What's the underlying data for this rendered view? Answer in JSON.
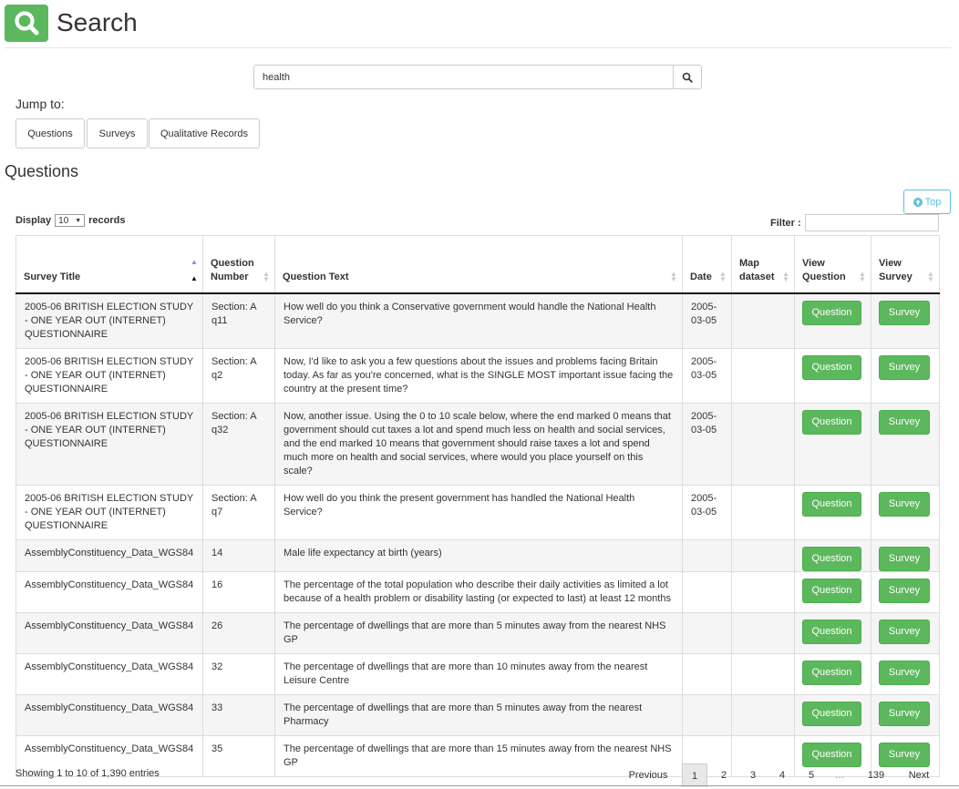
{
  "header": {
    "title": "Search",
    "logo_icon": "search-icon",
    "brand_color": "#5cb85c"
  },
  "search": {
    "value": "health",
    "button_icon": "search-icon"
  },
  "jump": {
    "label": "Jump to:",
    "buttons": [
      "Questions",
      "Surveys",
      "Qualitative Records"
    ]
  },
  "section": {
    "title": "Questions",
    "top_label": "Top",
    "top_icon": "arrow-up-circle-icon"
  },
  "table_controls": {
    "display_prefix": "Display",
    "display_value": "10",
    "display_suffix": "records",
    "filter_label": "Filter :",
    "filter_value": ""
  },
  "table": {
    "headers": [
      [
        "Survey Title"
      ],
      [
        "Question",
        "Number"
      ],
      [
        "Question Text"
      ],
      [
        "Date"
      ],
      [
        "Map",
        "dataset"
      ],
      [
        "View",
        "Question"
      ],
      [
        "View",
        "Survey"
      ]
    ],
    "sorted_column": "Survey Title",
    "rows": [
      {
        "survey": "2005-06 BRITISH ELECTION STUDY - ONE YEAR OUT (INTERNET) QUESTIONNAIRE",
        "number": "Section: A q11",
        "text": "How well do you think a Conservative government would handle the National Health Service?",
        "date": "2005-03-05",
        "map": ""
      },
      {
        "survey": "2005-06 BRITISH ELECTION STUDY - ONE YEAR OUT (INTERNET) QUESTIONNAIRE",
        "number": "Section: A q2",
        "text": "Now, I'd like to ask you a few questions about the issues and problems facing Britain today. As far as you're concerned, what is the SINGLE MOST important issue facing the country at the present time?",
        "date": "2005-03-05",
        "map": ""
      },
      {
        "survey": "2005-06 BRITISH ELECTION STUDY - ONE YEAR OUT (INTERNET) QUESTIONNAIRE",
        "number": "Section: A q32",
        "text": "Now, another issue. Using the 0 to 10 scale below, where the end marked 0 means that government should cut taxes a lot and spend much less on health and social services, and the end marked 10 means that government should raise taxes a lot and spend much more on health and social services, where would you place yourself on this scale?",
        "date": "2005-03-05",
        "map": ""
      },
      {
        "survey": "2005-06 BRITISH ELECTION STUDY - ONE YEAR OUT (INTERNET) QUESTIONNAIRE",
        "number": "Section: A q7",
        "text": "How well do you think the present government has handled the National Health Service?",
        "date": "2005-03-05",
        "map": ""
      },
      {
        "survey": "AssemblyConstituency_Data_WGS84",
        "number": "14",
        "text": "Male life expectancy at birth (years)",
        "date": "",
        "map": ""
      },
      {
        "survey": "AssemblyConstituency_Data_WGS84",
        "number": "16",
        "text": "The percentage of the total population who describe their daily activities as limited a lot because of a health problem or disability lasting (or expected to last) at least 12 months",
        "date": "",
        "map": ""
      },
      {
        "survey": "AssemblyConstituency_Data_WGS84",
        "number": "26",
        "text": "The percentage of dwellings that are more than 5 minutes away from the nearest NHS GP",
        "date": "",
        "map": ""
      },
      {
        "survey": "AssemblyConstituency_Data_WGS84",
        "number": "32",
        "text": "The percentage of dwellings that are more than 10 minutes away from the nearest Leisure Centre",
        "date": "",
        "map": ""
      },
      {
        "survey": "AssemblyConstituency_Data_WGS84",
        "number": "33",
        "text": "The percentage of dwellings that are more than 5 minutes away from the nearest Pharmacy",
        "date": "",
        "map": ""
      },
      {
        "survey": "AssemblyConstituency_Data_WGS84",
        "number": "35",
        "text": "The percentage of dwellings that are more than 15 minutes away from the nearest NHS GP",
        "date": "",
        "map": ""
      }
    ],
    "question_button_label": "Question",
    "survey_button_label": "Survey"
  },
  "footer": {
    "info": "Showing 1 to 10 of 1,390 entries",
    "pagination": [
      "Previous",
      "1",
      "2",
      "3",
      "4",
      "5",
      "…",
      "139",
      "Next"
    ],
    "current_page": "1"
  }
}
